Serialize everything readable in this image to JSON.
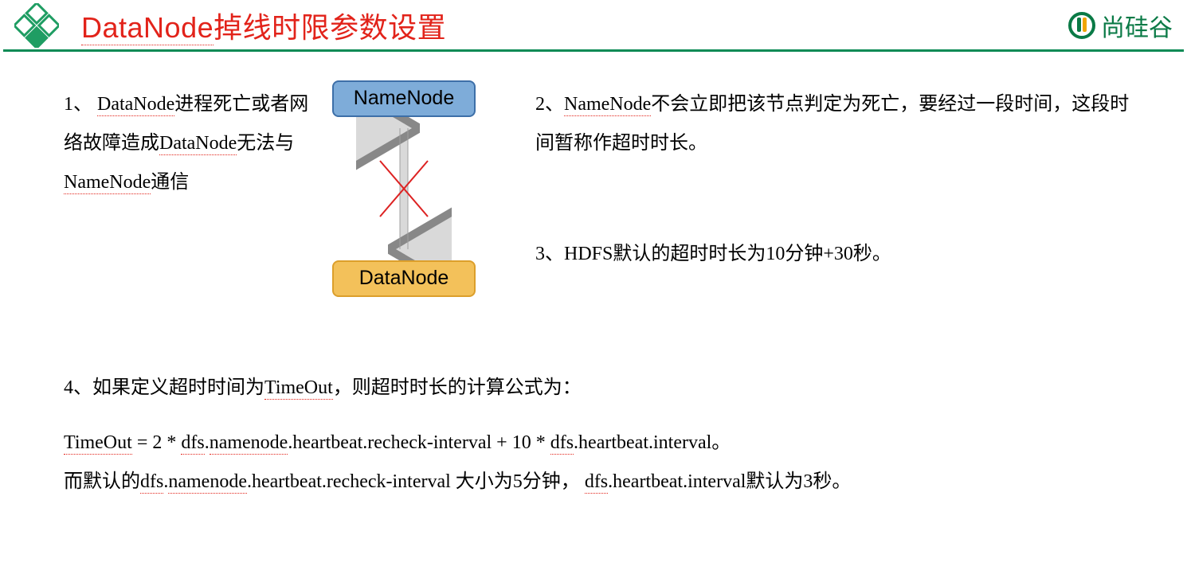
{
  "header": {
    "title_html": "<span class='u'>DataNode</span>掉线时限参数设置",
    "brand": "尚硅谷"
  },
  "diagram": {
    "top_label": "NameNode",
    "bottom_label": "DataNode"
  },
  "points": {
    "p1_html": "1、 <span class='u'>DataNode</span>进程死亡或者网络故障造成<span class='u'>DataNode</span>无法与<span class='u'>NameNode</span>通信",
    "p2_html": "2、<span class='u'>NameNode</span>不会立即把该节点判定为死亡，要经过一段时间，这段时间暂称作超时时长。",
    "p3_html": "3、HDFS默认的超时时长为10分钟+30秒。",
    "p4_html": "4、如果定义超时时间为<span class='u'>TimeOut</span>，则超时时长的计算公式为：",
    "formula_html": "<span class='u'>TimeOut</span> = 2 * <span class='u'>dfs</span>.<span class='u'>namenode</span>.heartbeat.recheck-interval + 10 * <span class='u'>dfs</span>.heartbeat.interval。",
    "defaults_html": "而默认的<span class='u'>dfs</span>.<span class='u'>namenode</span>.heartbeat.recheck-interval 大小为5分钟， <span class='u'>dfs</span>.heartbeat.interval默认为3秒。"
  }
}
